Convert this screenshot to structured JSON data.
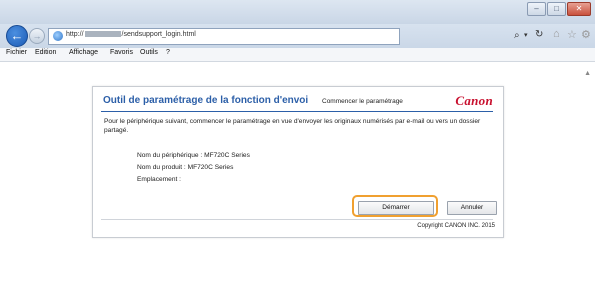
{
  "browser": {
    "window_controls": [
      "–",
      "□",
      "✕"
    ],
    "url_prefix": "http://",
    "url_suffix": "/sendsupport_login.html",
    "menu": [
      "Fichier",
      "Edition",
      "Affichage",
      "Favoris",
      "Outils",
      "?"
    ]
  },
  "dialog": {
    "title": "Outil de paramétrage de la fonction d'envoi",
    "subtitle": "Commencer le paramétrage",
    "logo": "Canon",
    "description": "Pour le périphérique suivant, commencer le paramétrage en vue d'envoyer les originaux numérisés par e-mail ou vers un dossier partagé.",
    "device_name": "Nom du périphérique : MF720C Series",
    "product_name": "Nom du produit : MF720C Series",
    "location": "Emplacement :",
    "start_button": "Démarrer",
    "cancel_button": "Annuler",
    "copyright": "Copyright CANON INC. 2015",
    "accent_color": "#2c5fa8",
    "highlight_color": "#f0a030"
  }
}
